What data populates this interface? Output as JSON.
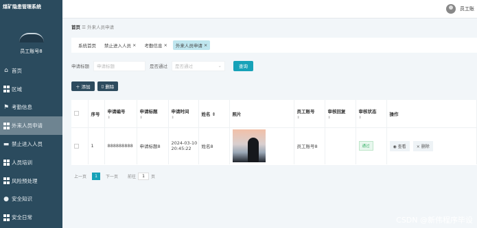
{
  "app": {
    "title": "煤矿隐患管理系统"
  },
  "sidebar": {
    "username": "员工账号8",
    "items": [
      {
        "label": "首页",
        "icon": "home-icon"
      },
      {
        "label": "区域",
        "icon": "grid-icon"
      },
      {
        "label": "考勤信息",
        "icon": "flag-icon"
      },
      {
        "label": "外来人员申请",
        "icon": "grid-icon"
      },
      {
        "label": "禁止进入人员",
        "icon": "monitor-icon"
      },
      {
        "label": "人员培训",
        "icon": "grid-icon"
      },
      {
        "label": "风险预处理",
        "icon": "grid-icon"
      },
      {
        "label": "安全知识",
        "icon": "user-icon"
      },
      {
        "label": "安全日常",
        "icon": "grid-icon"
      }
    ]
  },
  "topbar": {
    "user": "员工账"
  },
  "breadcrumb": {
    "home": "首页",
    "sep": "☰",
    "current": "外来人员申请"
  },
  "tags": [
    {
      "label": "系统首页",
      "closable": false
    },
    {
      "label": "禁止进入人员",
      "closable": true
    },
    {
      "label": "考勤信息",
      "closable": true
    },
    {
      "label": "外来人员申请",
      "closable": true
    }
  ],
  "search": {
    "title_label": "申请标题",
    "title_placeholder": "申请标题",
    "audit_label": "是否通过",
    "audit_placeholder": "是否通过",
    "search_button": "查询"
  },
  "actions": {
    "add": "添加",
    "delete": "删除"
  },
  "table": {
    "headers": [
      "序号",
      "申请编号",
      "申请标题",
      "申请时间",
      "姓名",
      "照片",
      "员工账号",
      "审核回复",
      "审核状态",
      "操作"
    ],
    "rows": [
      {
        "index": "1",
        "code": "888888888",
        "title": "申请标题8",
        "time_date": "2024-03-10",
        "time_clock": "20:45:22",
        "name": "姓名8",
        "account": "员工账号8",
        "reply": "",
        "status": "通过"
      }
    ],
    "view_label": "查看",
    "delete_label": "删除"
  },
  "pager": {
    "prev": "上一页",
    "page": "1",
    "next": "下一页",
    "goto_prefix": "前往",
    "goto_value": "1",
    "goto_suffix": "页"
  },
  "watermark": "CSDN @新伟程序毕设"
}
